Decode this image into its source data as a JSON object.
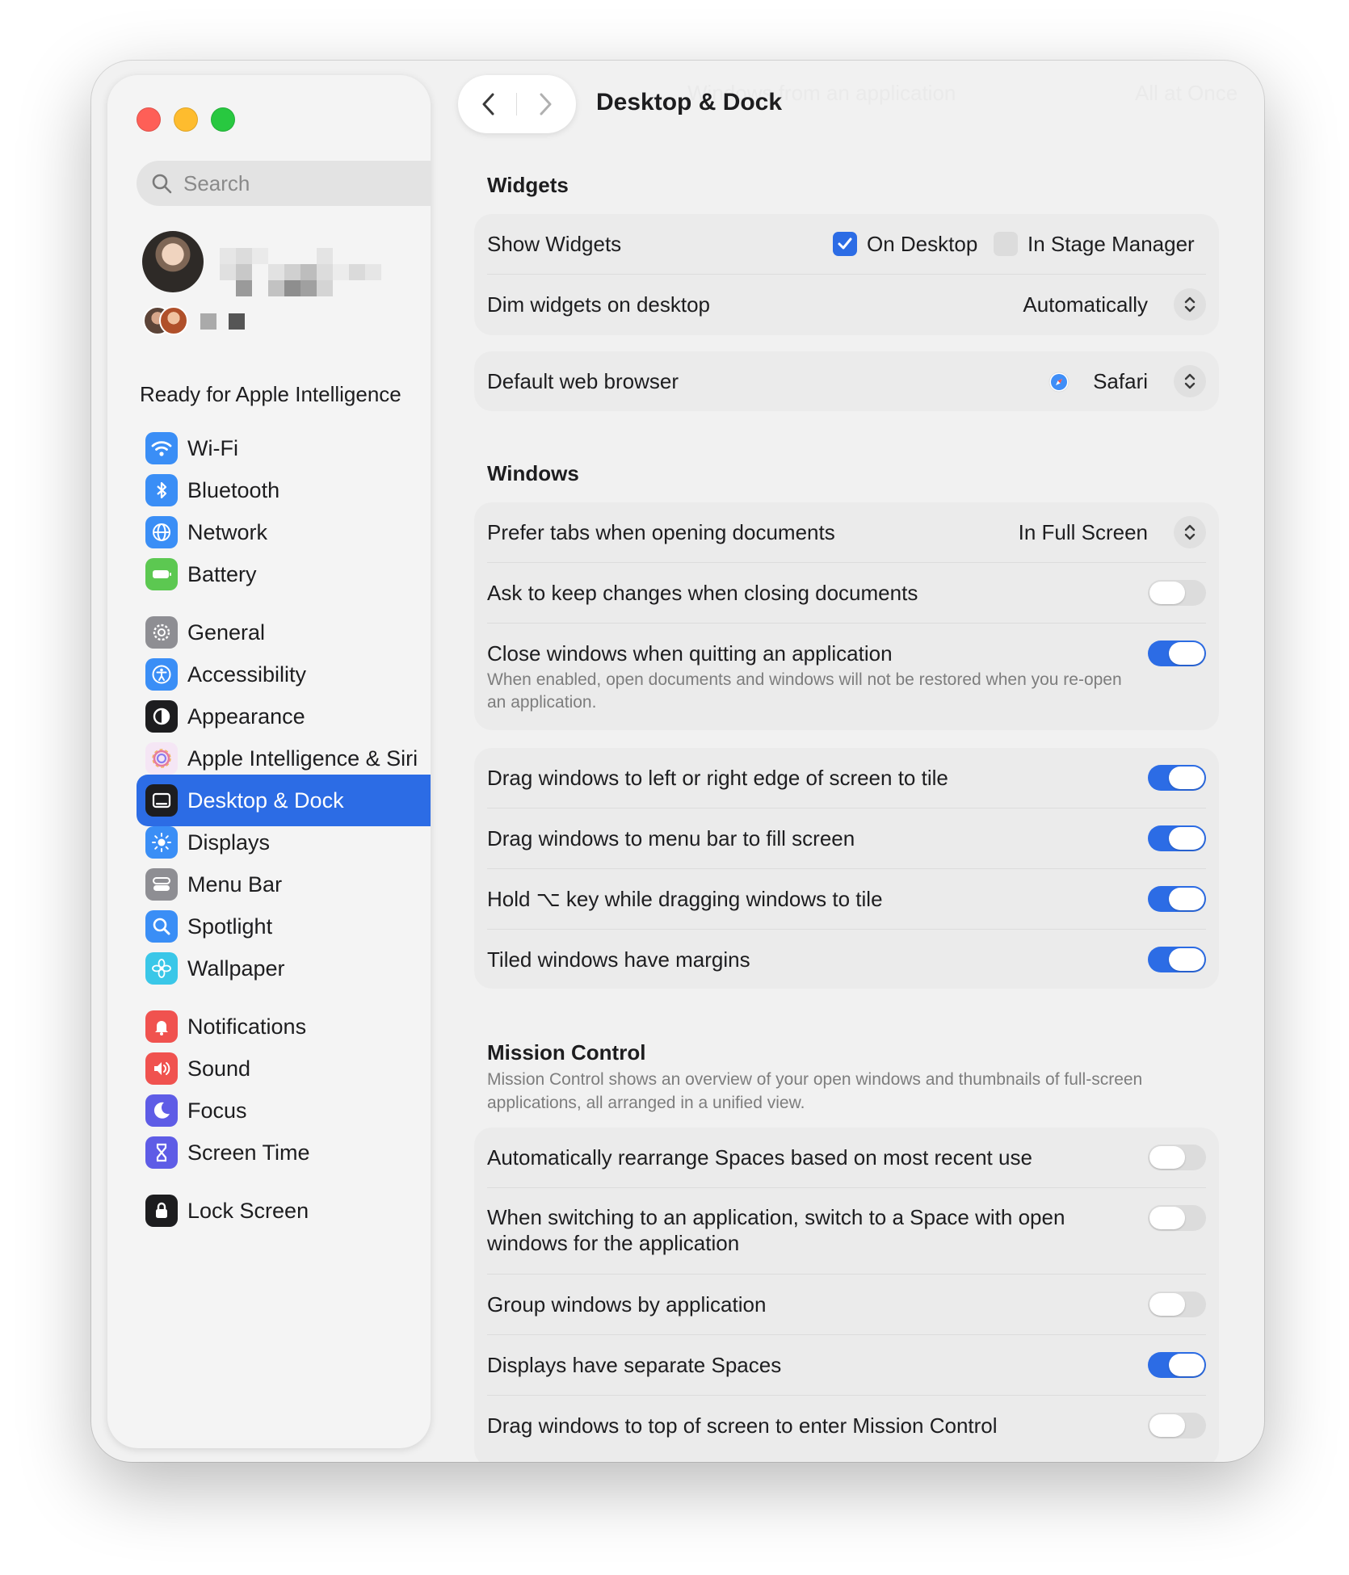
{
  "window": {
    "title": "Desktop & Dock"
  },
  "search": {
    "placeholder": "Search"
  },
  "account": {
    "status": "Ready for Apple Intelligence"
  },
  "sidebar": {
    "group1": [
      {
        "label": "Wi-Fi",
        "icon": "wifi-icon",
        "color": "#3a8ef6"
      },
      {
        "label": "Bluetooth",
        "icon": "bluetooth-icon",
        "color": "#3a8ef6"
      },
      {
        "label": "Network",
        "icon": "globe-icon",
        "color": "#3a8ef6"
      },
      {
        "label": "Battery",
        "icon": "battery-icon",
        "color": "#5cc851"
      }
    ],
    "group2": [
      {
        "label": "General",
        "icon": "gear-icon",
        "color": "#8e8e93"
      },
      {
        "label": "Accessibility",
        "icon": "accessibility-icon",
        "color": "#3a8ef6"
      },
      {
        "label": "Appearance",
        "icon": "appearance-icon",
        "color": "#1d1d1f"
      },
      {
        "label": "Apple Intelligence & Siri",
        "icon": "apple-intelligence-icon",
        "color": "#e2a0e8"
      },
      {
        "label": "Desktop & Dock",
        "icon": "dock-icon",
        "color": "#1d1d1f",
        "active": true
      },
      {
        "label": "Displays",
        "icon": "sun-icon",
        "color": "#3a8ef6"
      },
      {
        "label": "Menu Bar",
        "icon": "menu-bar-icon",
        "color": "#8e8e93"
      },
      {
        "label": "Spotlight",
        "icon": "magnifier-icon",
        "color": "#3a8ef6"
      },
      {
        "label": "Wallpaper",
        "icon": "flower-icon",
        "color": "#3ac7e8"
      }
    ],
    "group3": [
      {
        "label": "Notifications",
        "icon": "bell-icon",
        "color": "#f0524f"
      },
      {
        "label": "Sound",
        "icon": "speaker-icon",
        "color": "#f0524f"
      },
      {
        "label": "Focus",
        "icon": "moon-icon",
        "color": "#5e5ce6"
      },
      {
        "label": "Screen Time",
        "icon": "hourglass-icon",
        "color": "#5e5ce6"
      }
    ],
    "group4": [
      {
        "label": "Lock Screen",
        "icon": "lock-icon",
        "color": "#1d1d1f"
      }
    ]
  },
  "widgets": {
    "heading": "Widgets",
    "show_widgets": {
      "label": "Show Widgets",
      "on_desktop": "On Desktop",
      "on_desktop_checked": true,
      "stage_manager": "In Stage Manager",
      "stage_manager_checked": false
    },
    "dim": {
      "label": "Dim widgets on desktop",
      "value": "Automatically"
    },
    "browser": {
      "label": "Default web browser",
      "value": "Safari",
      "icon": "safari-icon"
    }
  },
  "windows": {
    "heading": "Windows",
    "prefer_tabs": {
      "label": "Prefer tabs when opening documents",
      "value": "In Full Screen"
    },
    "ask_keep": {
      "label": "Ask to keep changes when closing documents",
      "on": false
    },
    "close_windows": {
      "label": "Close windows when quitting an application",
      "sub": "When enabled, open documents and windows will not be restored when you re-open an application.",
      "on": true
    },
    "tiling": [
      {
        "label": "Drag windows to left or right edge of screen to tile",
        "on": true
      },
      {
        "label": "Drag windows to menu bar to fill screen",
        "on": true
      },
      {
        "label": "Hold ⌥ key while dragging windows to tile",
        "on": true
      },
      {
        "label": "Tiled windows have margins",
        "on": true
      }
    ]
  },
  "mission_control": {
    "heading": "Mission Control",
    "sub": "Mission Control shows an overview of your open windows and thumbnails of full-screen applications, all arranged in a unified view.",
    "rows": [
      {
        "label": "Automatically rearrange Spaces based on most recent use",
        "on": false
      },
      {
        "label": "When switching to an application, switch to a Space with open windows for the application",
        "on": false
      },
      {
        "label": "Group windows by application",
        "on": false
      },
      {
        "label": "Displays have separate Spaces",
        "on": true
      },
      {
        "label": "Drag windows to top of screen to enter Mission Control",
        "on": false
      }
    ]
  },
  "faded_header": {
    "left": "Windows from an application",
    "right": "All at Once"
  }
}
